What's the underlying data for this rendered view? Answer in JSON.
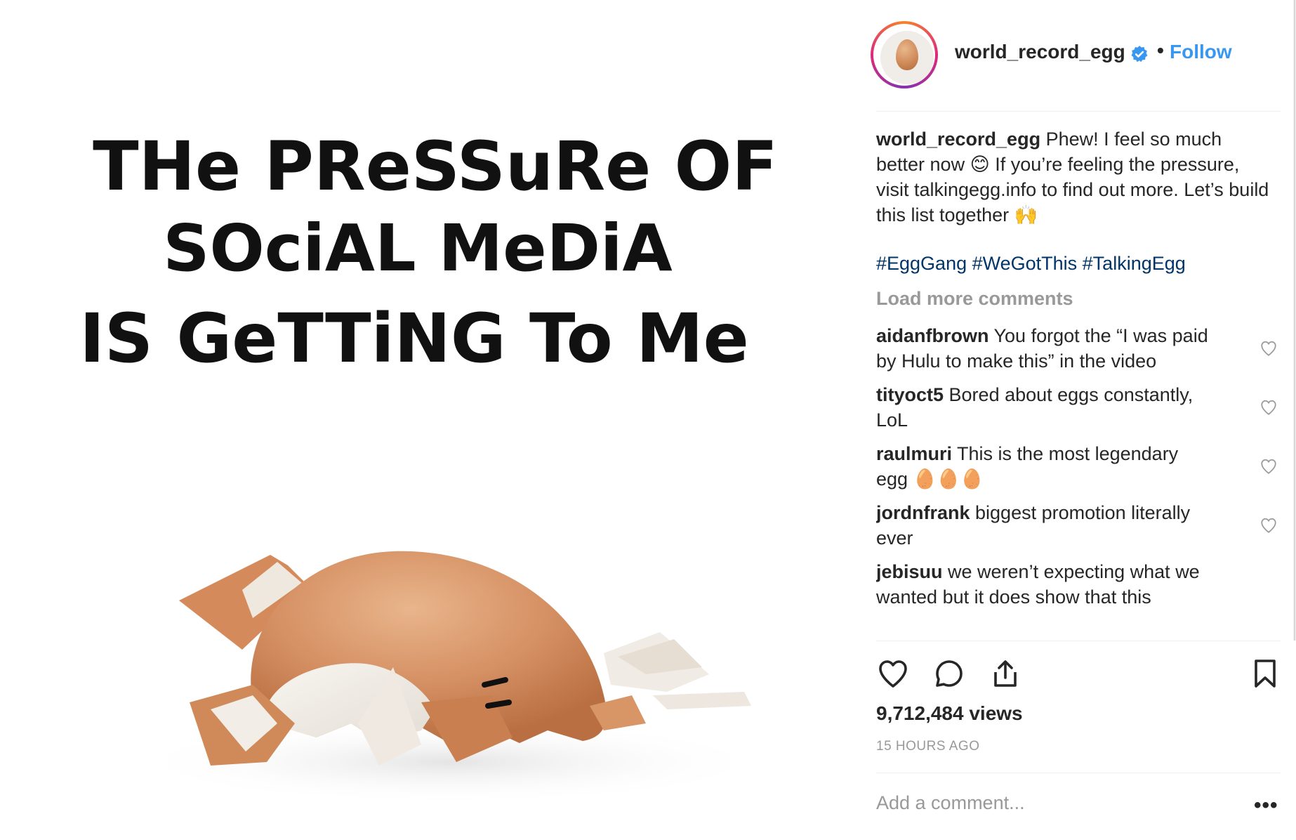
{
  "media": {
    "headline_line1": "THe PReSSuRe OF",
    "headline_line2": "SOciAL MeDiA",
    "headline_line3": "IS GeTTiNG To Me"
  },
  "post": {
    "author": "world_record_egg",
    "follow_label": "Follow",
    "caption_author": "world_record_egg",
    "caption_text": " Phew! I feel so much better now 😊 If you’re feeling the pressure, visit talkingegg.info to find out more. Let’s build this list together 🙌",
    "hashtags": "#EggGang #WeGotThis #TalkingEgg",
    "load_more": "Load more comments",
    "views": "9,712,484 views",
    "timestamp": "15 HOURS AGO",
    "add_comment_placeholder": "Add a comment..."
  },
  "comments": [
    {
      "user": "aidanfbrown",
      "text": " You forgot the “I was paid by Hulu to make this” in the video"
    },
    {
      "user": "tityoct5",
      "text": " Bored about eggs constantly, LoL"
    },
    {
      "user": "raulmuri",
      "text": " This is the most legendary egg 🥚🥚🥚"
    },
    {
      "user": "jordnfrank",
      "text": " biggest promotion literally ever"
    },
    {
      "user": "jebisuu",
      "text": " we weren’t expecting what we wanted but it does show that this"
    }
  ],
  "colors": {
    "link": "#3897f0",
    "hashtag": "#003569",
    "muted": "#999999",
    "text": "#262626"
  },
  "icons": [
    "verified-icon",
    "heart-icon",
    "comment-icon",
    "share-icon",
    "bookmark-icon",
    "more-options-icon"
  ]
}
